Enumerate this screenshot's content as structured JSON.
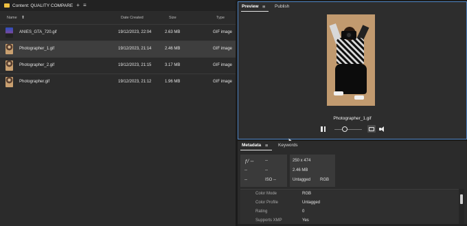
{
  "content": {
    "title": "Content: QUALITY COMPARE",
    "add_glyph": "+",
    "menu_glyph": "≡",
    "columns": {
      "name": "Name",
      "sort_glyph": "⬆",
      "date": "Date Created",
      "size": "Size",
      "type": "Type"
    },
    "files": [
      {
        "name": "ANIES_GTA_720.gif",
        "date": "19/12/2023, 22:04",
        "size": "2.63 MB",
        "type": "GIF image",
        "thumb": "anies-thumbnail",
        "selected": false
      },
      {
        "name": "Photographer_1.gif",
        "date": "19/12/2023, 21:14",
        "size": "2.46 MB",
        "type": "GIF image",
        "thumb": "photographer-thumbnail",
        "selected": true
      },
      {
        "name": "Photographer_2.gif",
        "date": "19/12/2023, 21:15",
        "size": "3.17 MB",
        "type": "GIF image",
        "thumb": "photographer-thumbnail",
        "selected": false
      },
      {
        "name": "Photographer.gif",
        "date": "19/12/2023, 21:12",
        "size": "1.96 MB",
        "type": "GIF image",
        "thumb": "photographer-thumbnail",
        "selected": false
      }
    ]
  },
  "preview": {
    "tabs": {
      "preview": "Preview",
      "menu_glyph": "≡",
      "publish": "Publish"
    },
    "caption": "Photographer_1.gif",
    "controls": {
      "pause": "pause-icon",
      "loop": "loop-icon",
      "volume": "volume-icon"
    }
  },
  "metadata": {
    "tabs": {
      "metadata": "Metadata",
      "menu_glyph": "≡",
      "keywords": "Keywords"
    },
    "camera": {
      "fstop": "ƒ/ --",
      "shutter": "--",
      "r2a": "--",
      "r2b": "--",
      "r3a": "--",
      "iso": "ISO --"
    },
    "file": {
      "dims": "250 x 474",
      "size": "2.46 MB",
      "tag": "Untagged",
      "mode": "RGB"
    },
    "properties": [
      {
        "label": "Color Mode",
        "value": "RGB"
      },
      {
        "label": "Color Profile",
        "value": "Untagged"
      },
      {
        "label": "Rating",
        "value": "0"
      },
      {
        "label": "Supports XMP",
        "value": "Yes"
      }
    ]
  },
  "colors": {
    "accent": "#4f86c6",
    "panel": "#2b2b2b",
    "selected_row": "#3e3e3e"
  }
}
